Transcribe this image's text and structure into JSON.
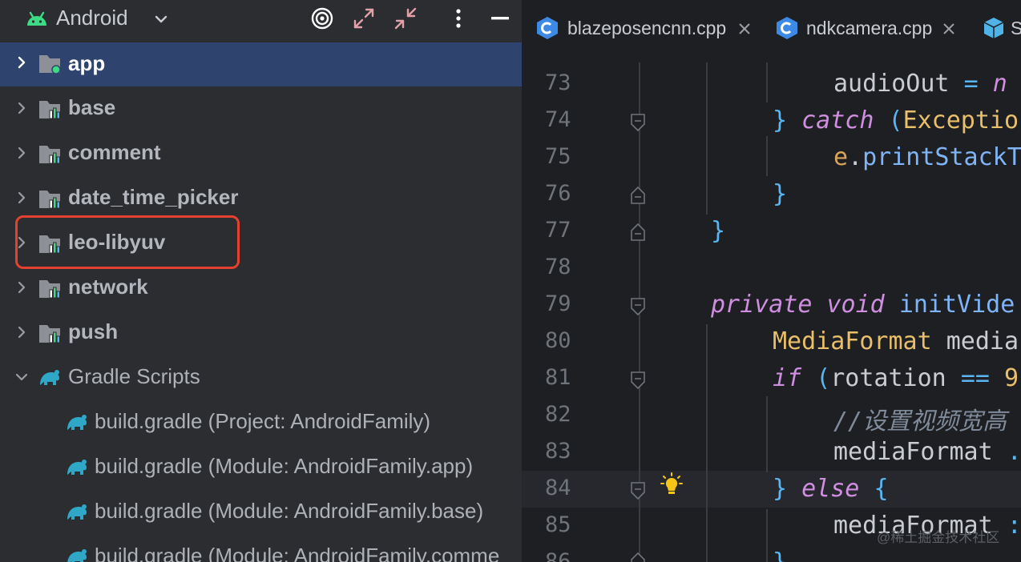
{
  "project_panel": {
    "view_title": "Android",
    "tree": [
      {
        "label": "app",
        "type": "app-module",
        "expanded": false,
        "selected": true
      },
      {
        "label": "base",
        "type": "module",
        "expanded": false
      },
      {
        "label": "comment",
        "type": "module",
        "expanded": false
      },
      {
        "label": "date_time_picker",
        "type": "module",
        "expanded": false
      },
      {
        "label": "leo-libyuv",
        "type": "module",
        "expanded": false,
        "highlighted": true
      },
      {
        "label": "network",
        "type": "module",
        "expanded": false
      },
      {
        "label": "push",
        "type": "module",
        "expanded": false
      },
      {
        "label": "Gradle Scripts",
        "type": "gradle-root",
        "expanded": true
      },
      {
        "label": "build.gradle (Project: AndroidFamily)",
        "type": "gradle-file"
      },
      {
        "label": "build.gradle (Module: AndroidFamily.app)",
        "type": "gradle-file"
      },
      {
        "label": "build.gradle (Module: AndroidFamily.base)",
        "type": "gradle-file"
      },
      {
        "label": "build.gradle (Module: AndroidFamily.comme",
        "type": "gradle-file"
      }
    ],
    "highlight_color": "#e5412f"
  },
  "editor": {
    "tabs": [
      {
        "label": "blazeposencnn.cpp",
        "icon": "cpp-file-icon",
        "closable": true
      },
      {
        "label": "ndkcamera.cpp",
        "icon": "cpp-file-icon",
        "closable": true
      },
      {
        "label": "S",
        "icon": "cube-file-icon",
        "closable": false
      }
    ],
    "line_numbers": [
      "73",
      "74",
      "75",
      "76",
      "77",
      "78",
      "79",
      "80",
      "81",
      "82",
      "83",
      "84",
      "85",
      "86"
    ],
    "current_line": "84",
    "code": {
      "l73": {
        "name": "audioOut",
        "op": "=",
        "rest": "n"
      },
      "l74": {
        "brace": "}",
        "kw": "catch",
        "paren": "(",
        "type": "Exceptio"
      },
      "l75": {
        "obj": "e",
        "dot": ".",
        "call": "printStackT"
      },
      "l76": {
        "brace": "}"
      },
      "l77": {
        "brace": "}"
      },
      "l79": {
        "kw1": "private",
        "kw2": "void",
        "fn": "initVide"
      },
      "l80": {
        "type": "MediaFormat",
        "name": "media"
      },
      "l81": {
        "kw": "if",
        "paren": "(",
        "name": "rotation",
        "op": "==",
        "rest": "9"
      },
      "l82": {
        "comment": "//设置视频宽高"
      },
      "l83": {
        "name": "mediaFormat",
        "rest": "."
      },
      "l84": {
        "brace": "}",
        "kw": "else",
        "brace2": "{"
      },
      "l85": {
        "name": "mediaFormat",
        "rest": ":"
      },
      "l86": {
        "brace": "}"
      }
    },
    "colors": {
      "keyword": "#cf8ee0",
      "type": "#e8bf6a",
      "function": "#7fb4f7",
      "brace": "#59b6f2",
      "comment": "#7f8b9a"
    }
  },
  "watermark": "@稀土掘金技术社区"
}
